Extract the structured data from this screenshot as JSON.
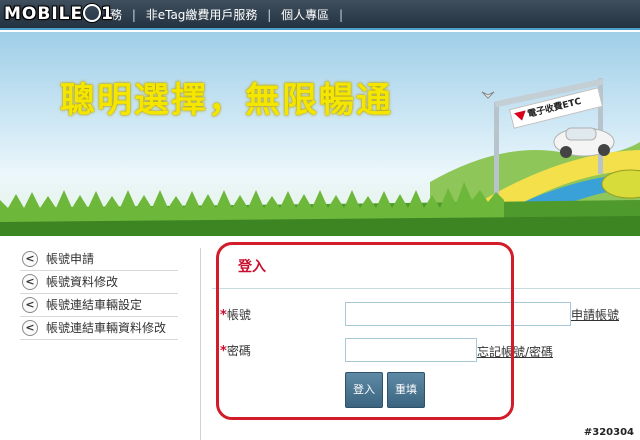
{
  "watermark": {
    "text": "MOBILE01"
  },
  "nav": {
    "partial_item": "務",
    "items": [
      "非eTag繳費用戶服務",
      "個人專區"
    ],
    "separator": "|"
  },
  "banner": {
    "slogan": "聰明選擇，無限暢通",
    "sign_text": "電子收費ETC"
  },
  "sidebar": {
    "items": [
      {
        "label": "帳號申請"
      },
      {
        "label": "帳號資料修改"
      },
      {
        "label": "帳號連結車輛設定"
      },
      {
        "label": "帳號連結車輛資料修改"
      }
    ],
    "arrow_glyph": "<"
  },
  "login": {
    "title": "登入",
    "required_mark": "*",
    "account_label": "帳號",
    "account_value": "",
    "apply_link": "申請帳號",
    "password_label": "密碼",
    "password_value": "",
    "forgot_link": "忘記帳號/密碼",
    "login_button": "登入",
    "reset_button": "重填"
  },
  "corner_tag": "#320304",
  "colors": {
    "title_red": "#c8102e",
    "highlight_red": "#d21c2a",
    "button_blue": "#3a6480",
    "slogan_yellow": "#f5e600"
  }
}
